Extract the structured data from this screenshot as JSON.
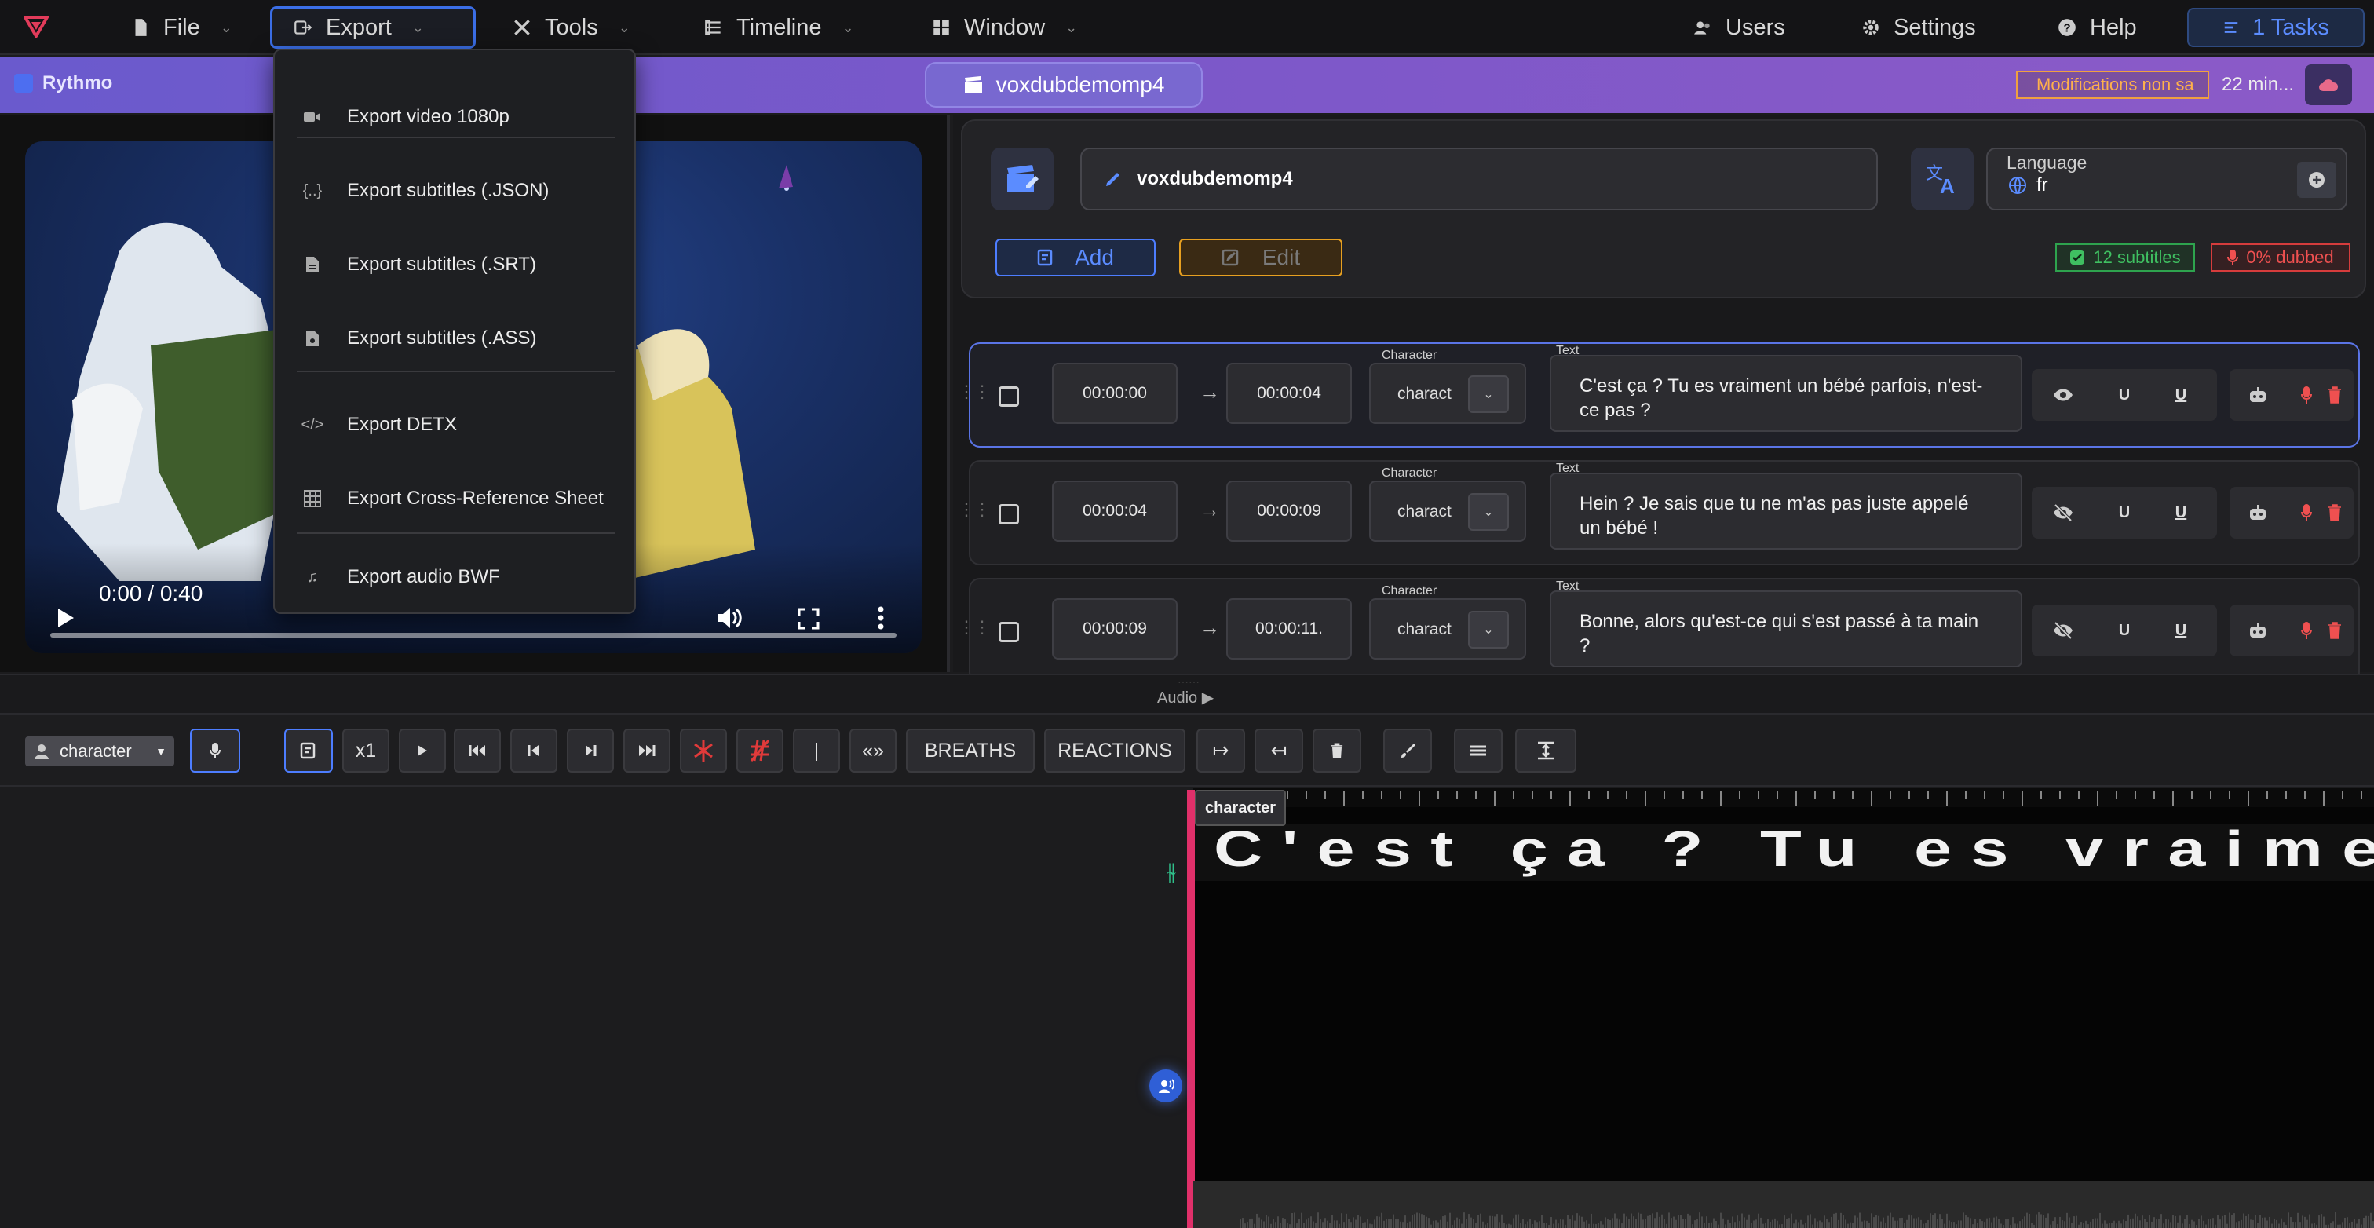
{
  "menubar": {
    "file": "File",
    "export": "Export",
    "tools": "Tools",
    "timeline": "Timeline",
    "window": "Window",
    "users": "Users",
    "settings": "Settings",
    "help": "Help",
    "tasks": "1 Tasks"
  },
  "export_menu": {
    "items": [
      {
        "label": "Export video 1080p",
        "icon": "video-icon"
      },
      {
        "label": "Export subtitles (.JSON)",
        "icon": "json-icon"
      },
      {
        "label": "Export subtitles (.SRT)",
        "icon": "document-icon"
      },
      {
        "label": "Export subtitles (.ASS)",
        "icon": "document-icon"
      },
      {
        "label": "Export DETX",
        "icon": "code-icon"
      },
      {
        "label": "Export Cross-Reference Sheet",
        "icon": "table-icon"
      },
      {
        "label": "Export audio BWF",
        "icon": "music-icon"
      }
    ]
  },
  "band": {
    "brand": "Rythmo",
    "project": "voxdubdemomp4",
    "unsaved": "Modifications non sa",
    "ago": "22 min..."
  },
  "video": {
    "time": "0:00 / 0:40"
  },
  "editor": {
    "title": "voxdubdemomp4",
    "language_label": "Language",
    "language_value": "fr",
    "add": "Add",
    "edit": "Edit",
    "subtitles_count": "12 subtitles",
    "dubbed": "0% dubbed"
  },
  "subtitles": {
    "character_label": "Character",
    "text_label": "Text",
    "rows": [
      {
        "start": "00:00:00",
        "end": "00:00:04",
        "character": "charact",
        "text": "C'est ça ? Tu es vraiment un bébé parfois, n'est-ce pas ?",
        "u1": "U",
        "u2": "U"
      },
      {
        "start": "00:00:04",
        "end": "00:00:09",
        "character": "charact",
        "text": "Hein ? Je sais que tu ne m'as pas juste appelé un bébé !",
        "u1": "U",
        "u2": "U"
      },
      {
        "start": "00:00:09",
        "end": "00:00:11.",
        "character": "charact",
        "text": "Bonne, alors qu'est-ce qui s'est passé à ta main ?",
        "u1": "U",
        "u2": "U"
      }
    ]
  },
  "audio": {
    "label": "Audio ▶"
  },
  "toolbar": {
    "character": "character",
    "speed": "x1",
    "cursor": "|",
    "quotes": "«»",
    "breaths": "BREATHS",
    "reactions": "REACTIONS"
  },
  "timeline": {
    "character_tag": "character",
    "rythmo_text": "C'est ça ? Tu es vraimen"
  },
  "colors": {
    "accent": "#4d7dff",
    "band": "#7c58c9",
    "playhead": "#e0306a",
    "success": "#3fc061",
    "danger": "#ef5050",
    "warning": "#ffb14a"
  }
}
